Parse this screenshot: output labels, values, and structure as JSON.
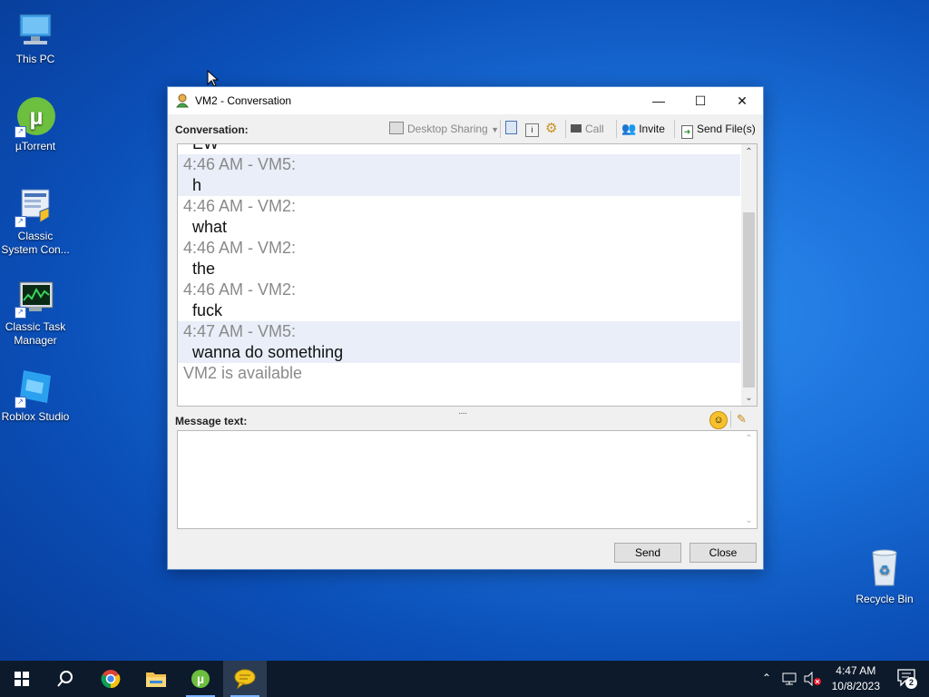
{
  "desktop": {
    "icons": [
      {
        "label": "This PC"
      },
      {
        "label": "µTorrent"
      },
      {
        "label": "Classic System Con..."
      },
      {
        "label": "Classic Task Manager"
      },
      {
        "label": "Roblox Studio"
      }
    ],
    "recycle_bin": {
      "label": "Recycle Bin"
    }
  },
  "window": {
    "title": "VM2 - Conversation",
    "conversation_label": "Conversation:",
    "toolbar": {
      "desktop_sharing": "Desktop Sharing",
      "call": "Call",
      "invite": "Invite",
      "send_files": "Send File(s)"
    },
    "messages": [
      {
        "header": "",
        "body": "EW",
        "alt": false
      },
      {
        "header": "4:46 AM - VM5:",
        "body": "h",
        "alt": true
      },
      {
        "header": "4:46 AM - VM2:",
        "body": "what",
        "alt": false
      },
      {
        "header": "4:46 AM - VM2:",
        "body": "the",
        "alt": false
      },
      {
        "header": "4:46 AM - VM2:",
        "body": "fuck",
        "alt": false
      },
      {
        "header": "4:47 AM - VM5:",
        "body": "wanna do something",
        "alt": true
      }
    ],
    "status_line": "VM2 is available",
    "message_text_label": "Message text:",
    "input": {
      "value": "",
      "placeholder": ""
    },
    "send_button": "Send",
    "close_button": "Close"
  },
  "taskbar": {
    "clock_time": "4:47 AM",
    "clock_date": "10/8/2023",
    "notification_count": "2"
  }
}
